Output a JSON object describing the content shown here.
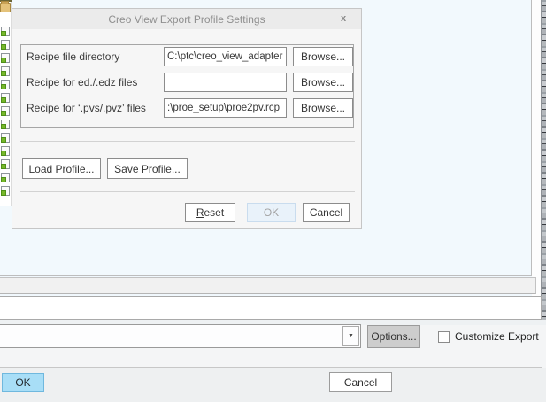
{
  "dialog": {
    "title": "Creo View Export Profile Settings",
    "close_glyph": "x",
    "fields": [
      {
        "label": "Recipe file directory",
        "value": "C:\\ptc\\creo_view_adapter",
        "browse": "Browse..."
      },
      {
        "label": "Recipe for ed./.edz files",
        "value": "",
        "browse": "Browse..."
      },
      {
        "label": "Recipe for ‘.pvs/.pvz’ files",
        "value": ":\\proe_setup\\proe2pv.rcp",
        "browse": "Browse..."
      }
    ],
    "load_profile_label": "Load Profile...",
    "save_profile_label": "Save Profile...",
    "reset_key": "R",
    "reset_rest": "eset",
    "ok_label": "OK",
    "cancel_label": "Cancel"
  },
  "export_bar": {
    "combo_value": "",
    "combo_arrow_glyph": "▼",
    "options_label": "Options...",
    "customize_export_label": "Customize Export",
    "customize_checked": false,
    "filename_value": ""
  },
  "window_footer": {
    "ok_label": "OK",
    "cancel_label": "Cancel"
  },
  "colors": {
    "accent_ok_button": "#a8def7",
    "dialog_titlebar": "#ebebeb",
    "canvas_blue": "#f2f9fd",
    "disabled_ok_fill": "#e9f2fa",
    "tree_part_green": "#76b82a"
  }
}
